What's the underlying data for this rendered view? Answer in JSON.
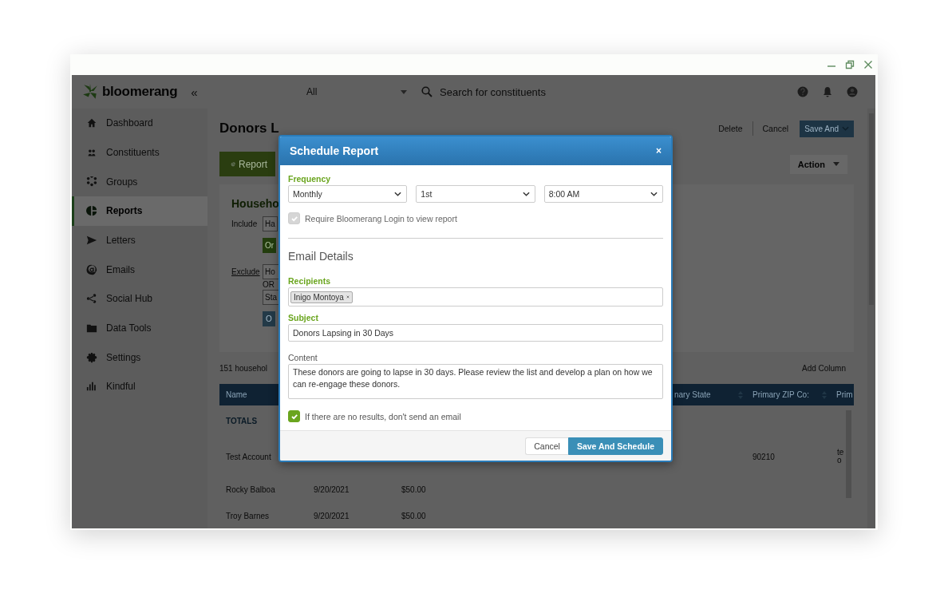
{
  "app": {
    "logo": "bloomerang",
    "collapse": "«",
    "sidebar": [
      {
        "label": "Dashboard",
        "selected": false
      },
      {
        "label": "Constituents",
        "selected": false
      },
      {
        "label": "Groups",
        "selected": false
      },
      {
        "label": "Reports",
        "selected": true
      },
      {
        "label": "Letters",
        "selected": false
      },
      {
        "label": "Emails",
        "selected": false
      },
      {
        "label": "Social Hub",
        "selected": false
      },
      {
        "label": "Data Tools",
        "selected": false
      },
      {
        "label": "Settings",
        "selected": false
      },
      {
        "label": "Kindful",
        "selected": false
      }
    ],
    "topbar": {
      "scope": "All",
      "search_placeholder": "Search for constituents"
    },
    "page_title": "Donors L",
    "header_buttons": {
      "delete": "Delete",
      "cancel": "Cancel",
      "save": "Save And"
    },
    "report_tab": "Report",
    "action": "Action",
    "filter": {
      "heading": "Househo",
      "include_label": "Include",
      "include_value": "Ha",
      "include_button": "Or",
      "exclude_label": "Exclude",
      "exclude_values": [
        "Ho",
        "Sta"
      ],
      "or_text": "OR",
      "exclude_button": "O"
    },
    "count_text": "151 househol",
    "add_column": "Add Column",
    "table": {
      "columns": {
        "name": "Name",
        "state": "nary State",
        "zip": "Primary ZIP Co:",
        "column_7": "Prim"
      },
      "totals_label": "TOTALS",
      "rows": [
        {
          "name": "Test Account",
          "zip": "90210",
          "column_7": "te\no"
        },
        {
          "name": "Rocky Balboa",
          "date": "9/20/2021",
          "amount": "$50.00"
        },
        {
          "name": "Troy Barnes",
          "date": "9/20/2021",
          "amount": "$50.00"
        }
      ]
    }
  },
  "dialog": {
    "title": "Schedule Report",
    "close": "×",
    "frequency": {
      "label": "Frequency",
      "required": true,
      "selects": [
        "Monthly",
        "1st",
        "8:00 AM"
      ]
    },
    "require_login": {
      "label": "Require Bloomerang Login to view report",
      "checked": true,
      "disabled": true
    },
    "section_title": "Email Details",
    "recipients": {
      "label": "Recipients",
      "required": true,
      "tags": [
        "Inigo Montoya"
      ]
    },
    "subject": {
      "label": "Subject",
      "required": true,
      "value": "Donors Lapsing in 30 Days"
    },
    "content": {
      "label": "Content",
      "required": false,
      "value": "These donors are going to lapse in 30 days. Please review the list and develop a plan on how we can re-engage these donors."
    },
    "no_results": {
      "label": "If there are no results, don't send an email",
      "checked": true,
      "disabled": false
    },
    "buttons": {
      "cancel": "Cancel",
      "save": "Save And Schedule"
    }
  }
}
